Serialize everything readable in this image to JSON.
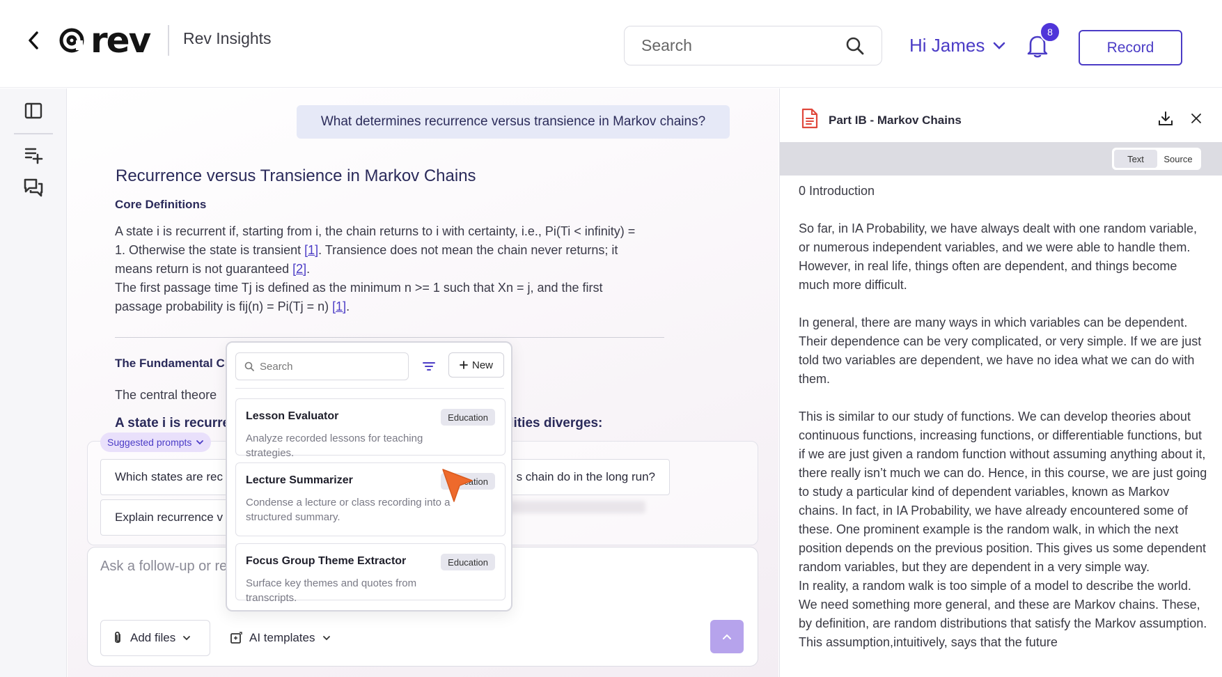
{
  "header": {
    "brand": "rev",
    "app_title": "Rev Insights",
    "search_placeholder": "Search",
    "greeting": "Hi James",
    "notification_count": "8",
    "record_label": "Record"
  },
  "main": {
    "question": "What determines recurrence versus transience in Markov chains?",
    "answer_title": "Recurrence versus Transience in Markov Chains",
    "core_definitions": "Core Definitions",
    "para1_a": "A state i is recurrent if, starting from i, the chain returns to i with certainty, i.e., Pi(Ti < infinity) = 1. Otherwise the state is transient ",
    "cite1": "[1]",
    "para1_b": ". Transience does not mean the chain never returns; it means return is not guaranteed ",
    "cite2": "[2]",
    "para1_c": ".",
    "para2_a": "The first passage time Tj is defined as the minimum n >= 1 such that Xn = j, and the first passage probability is fij(n) = Pi(Tj = n) ",
    "cite3": "[1]",
    "para2_b": ".",
    "fundamental_title": "The Fundamental Cl",
    "central_text": "The central theore",
    "recur_line": "A state i is recurre",
    "recur_line_right": "ilities diverges:",
    "suggested_prompts_label": "Suggested prompts",
    "chips": [
      "Which states are rec",
      "s chain do in the long run?",
      "Explain recurrence v"
    ],
    "input_placeholder": "Ask a follow-up or re",
    "add_files": "Add files",
    "ai_templates": "AI templates"
  },
  "popover": {
    "search_placeholder": "Search",
    "new_label": "New",
    "templates": [
      {
        "name": "Lesson Evaluator",
        "tag": "Education",
        "desc": "Analyze recorded lessons for teaching strategies."
      },
      {
        "name": "Lecture Summarizer",
        "tag": "Education",
        "desc": "Condense a lecture or class recording into a structured summary."
      },
      {
        "name": "Focus Group Theme Extractor",
        "tag": "Education",
        "desc": "Surface key themes and quotes from transcripts."
      }
    ]
  },
  "doc": {
    "title": "Part IB - Markov Chains",
    "toggle_text": "Text",
    "toggle_source": "Source",
    "section": "0 Introduction",
    "p1": "So far, in IA Probability, we have always dealt with one random variable, or numerous independent variables, and we were able to handle them. However, in real life, things often are dependent, and things become much more difficult.",
    "p2": "In general, there are many ways in which variables can be dependent. Their dependence can be very complicated, or very simple. If we are just told two variables are dependent, we have no idea what we can do with them.",
    "p3": "This is similar to our study of functions. We can develop theories about continuous functions, increasing functions, or differentiable functions, but if we are just given a random function without assuming anything about it, there really isn’t much we can do. Hence, in this course, we are just going to study a particular kind of dependent variables, known as Markov chains. In fact, in IA Probability, we have already encountered some of these. One prominent example is the random walk, in which the next position depends on the previous position. This gives us some dependent random variables, but they are dependent in a very simple way.",
    "p4": "In reality, a random walk is too simple of a model to describe the world. We need something more general, and these are Markov chains. These, by definition, are random distributions that satisfy the Markov assumption. This assumption,intuitively, says that the future"
  },
  "colors": {
    "accent": "#4b3cc6",
    "badge": "#4f35d9",
    "question_bg": "#e6e9f7",
    "cursor": "#ee6a2c"
  }
}
